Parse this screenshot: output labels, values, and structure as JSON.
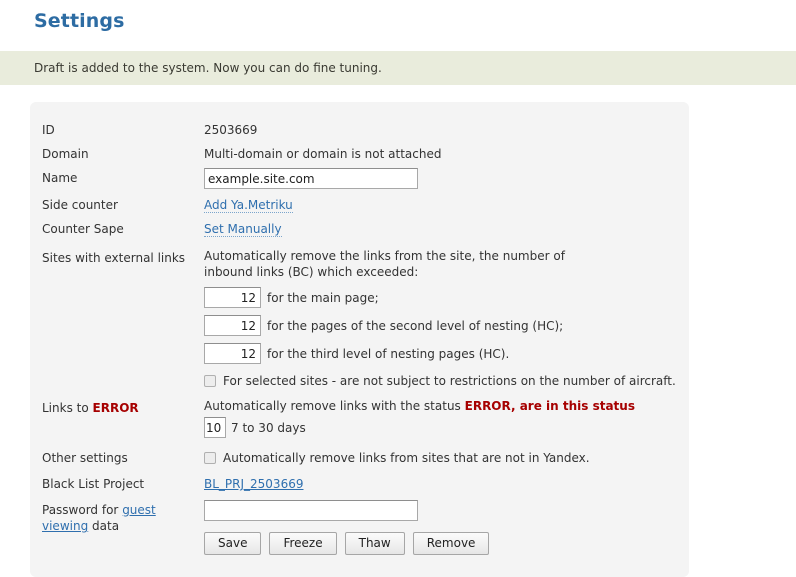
{
  "page": {
    "title": "Settings",
    "notice": "Draft is added to the system. Now you can do fine tuning."
  },
  "form": {
    "id": {
      "label": "ID",
      "value": "2503669"
    },
    "domain": {
      "label": "Domain",
      "value": "Multi-domain or domain is not attached"
    },
    "name": {
      "label": "Name",
      "value": "example.site.com"
    },
    "side_counter": {
      "label": "Side counter",
      "link": "Add Ya.Metriku"
    },
    "counter_sape": {
      "label": "Counter Sape",
      "link": "Set Manually"
    },
    "external_links": {
      "label": "Sites with external links",
      "description_line1": "Automatically remove the links from the site, the number of",
      "description_line2": "inbound links (BC) which exceeded:",
      "fields": [
        {
          "value": "12",
          "after": "for the main page;"
        },
        {
          "value": "12",
          "after": "for the pages of the second level of nesting (HC);"
        },
        {
          "value": "12",
          "after": "for the third level of nesting pages (HC)."
        }
      ],
      "checkbox_label": "For selected sites - are not subject to restrictions on the number of aircraft."
    },
    "links_to_error": {
      "label_prefix": "Links to ",
      "label_emphasis": "ERROR",
      "description_prefix": "Automatically remove links with the status ",
      "description_emphasis": "ERROR, are in this status",
      "days_value": "10",
      "days_after": "7 to 30 days"
    },
    "other_settings": {
      "label": "Other settings",
      "checkbox_label": "Automatically remove links from sites that are not in Yandex."
    },
    "black_list": {
      "label": "Black List Project",
      "link": "BL_PRJ_2503669"
    },
    "password": {
      "label_prefix": "Password for ",
      "label_link": "guest viewing",
      "label_suffix": " data",
      "value": "",
      "placeholder": ""
    },
    "buttons": [
      {
        "name": "save-button",
        "label": "Save"
      },
      {
        "name": "freeze-button",
        "label": "Freeze"
      },
      {
        "name": "thaw-button",
        "label": "Thaw"
      },
      {
        "name": "remove-button",
        "label": "Remove"
      }
    ]
  },
  "colors": {
    "title": "#2d6ca3",
    "notice_bg": "#e9ecdc",
    "panel_bg": "#f4f4f4",
    "link": "#2f6fae",
    "error_red": "#a60000"
  }
}
